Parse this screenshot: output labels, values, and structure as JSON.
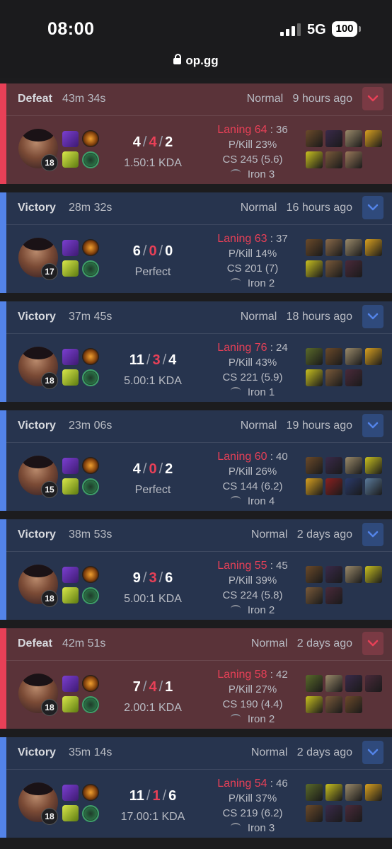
{
  "status_bar": {
    "time": "08:00",
    "network": "5G",
    "battery": "100"
  },
  "browser": {
    "url": "op.gg"
  },
  "matches": [
    {
      "result": "Defeat",
      "duration": "43m 34s",
      "mode": "Normal",
      "ago": "9 hours ago",
      "level": "18",
      "kills": "4",
      "deaths": "4",
      "assists": "2",
      "kda_ratio": "1.50:1 KDA",
      "laning": "Laning 64",
      "laning_opp": ": 36",
      "pkill": "P/Kill 23%",
      "cs": "CS 245 (5.6)",
      "rank": "Iron 3",
      "items": [
        "#6b4a2a",
        "#3a2a4a",
        "#9a8a6a",
        "#d8a020",
        "#c8c020",
        "#7a5a3a",
        "#9a7a5a"
      ]
    },
    {
      "result": "Victory",
      "duration": "28m 32s",
      "mode": "Normal",
      "ago": "16 hours ago",
      "level": "17",
      "kills": "6",
      "deaths": "0",
      "assists": "0",
      "kda_ratio": "Perfect",
      "laning": "Laning 63",
      "laning_opp": ": 37",
      "pkill": "P/Kill 14%",
      "cs": "CS 201 (7)",
      "rank": "Iron 2",
      "items": [
        "#6b4a2a",
        "#8a6a4a",
        "#9a8a6a",
        "#d8a020",
        "#c8c020",
        "#7a5a3a",
        "#4a2a3a"
      ]
    },
    {
      "result": "Victory",
      "duration": "37m 45s",
      "mode": "Normal",
      "ago": "18 hours ago",
      "level": "18",
      "kills": "11",
      "deaths": "3",
      "assists": "4",
      "kda_ratio": "5.00:1 KDA",
      "laning": "Laning 76",
      "laning_opp": ": 24",
      "pkill": "P/Kill 43%",
      "cs": "CS 221 (5.9)",
      "rank": "Iron 1",
      "items": [
        "#5a6a2a",
        "#6b4a2a",
        "#9a8a6a",
        "#d8a020",
        "#c8c020",
        "#7a5a3a",
        "#4a2a3a"
      ]
    },
    {
      "result": "Victory",
      "duration": "23m 06s",
      "mode": "Normal",
      "ago": "19 hours ago",
      "level": "15",
      "kills": "4",
      "deaths": "0",
      "assists": "2",
      "kda_ratio": "Perfect",
      "laning": "Laning 60",
      "laning_opp": ": 40",
      "pkill": "P/Kill 26%",
      "cs": "CS 144 (6.2)",
      "rank": "Iron 4",
      "items": [
        "#6b4a2a",
        "#3a2a4a",
        "#9a8a6a",
        "#c8c020",
        "#d8a020",
        "#8a2020",
        "#2a3a6a",
        "#5a7a9a"
      ]
    },
    {
      "result": "Victory",
      "duration": "38m 53s",
      "mode": "Normal",
      "ago": "2 days ago",
      "level": "18",
      "kills": "9",
      "deaths": "3",
      "assists": "6",
      "kda_ratio": "5.00:1 KDA",
      "laning": "Laning 55",
      "laning_opp": ": 45",
      "pkill": "P/Kill 39%",
      "cs": "CS 224 (5.8)",
      "rank": "Iron 2",
      "items": [
        "#6b4a2a",
        "#3a2a4a",
        "#9a8a6a",
        "#c8c020",
        "#7a5a3a",
        "#4a2a3a"
      ]
    },
    {
      "result": "Defeat",
      "duration": "42m 51s",
      "mode": "Normal",
      "ago": "2 days ago",
      "level": "18",
      "kills": "7",
      "deaths": "4",
      "assists": "1",
      "kda_ratio": "2.00:1 KDA",
      "laning": "Laning 58",
      "laning_opp": ": 42",
      "pkill": "P/Kill 27%",
      "cs": "CS 190 (4.4)",
      "rank": "Iron 2",
      "items": [
        "#5a6a2a",
        "#9a8a6a",
        "#3a2a4a",
        "#4a2a3a",
        "#c8c020",
        "#7a5a3a",
        "#6b4a2a"
      ]
    },
    {
      "result": "Victory",
      "duration": "35m 14s",
      "mode": "Normal",
      "ago": "2 days ago",
      "level": "18",
      "kills": "11",
      "deaths": "1",
      "assists": "6",
      "kda_ratio": "17.00:1 KDA",
      "laning": "Laning 54",
      "laning_opp": ": 46",
      "pkill": "P/Kill 37%",
      "cs": "CS 219 (6.2)",
      "rank": "Iron 3",
      "items": [
        "#5a6a2a",
        "#c8c020",
        "#9a8a6a",
        "#d8a020",
        "#6b4a2a",
        "#3a2a4a",
        "#4a2a3a"
      ]
    }
  ]
}
